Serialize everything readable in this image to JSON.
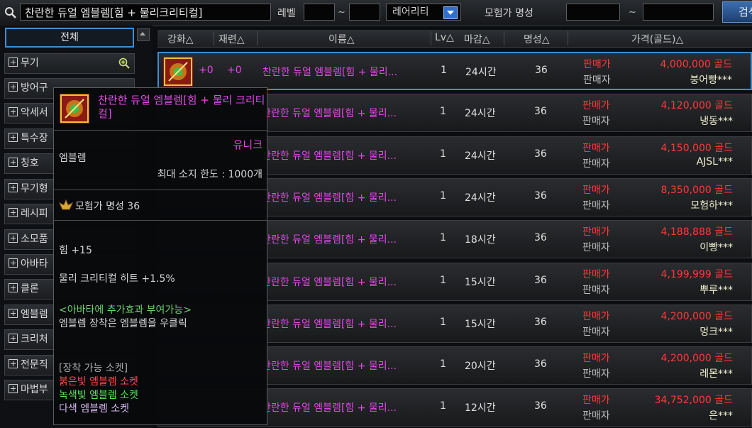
{
  "search": {
    "value": "찬란한 듀얼 엠블렘[힘 + 물리크리티컬]",
    "level_label": "레벨",
    "tilde": "~",
    "rarity": "레어리티",
    "fame_label": "모험가 명성",
    "button": "검색"
  },
  "sidebar": {
    "all": "전체",
    "items": [
      {
        "label": "무기"
      },
      {
        "label": "방어구"
      },
      {
        "label": "악세서"
      },
      {
        "label": "특수장"
      },
      {
        "label": "칭호"
      },
      {
        "label": "무기형"
      },
      {
        "label": "레시피"
      },
      {
        "label": "소모품"
      },
      {
        "label": "아바타"
      },
      {
        "label": "클론"
      },
      {
        "label": "엠블렘"
      },
      {
        "label": "크리처"
      },
      {
        "label": "전문직"
      },
      {
        "label": "마법부"
      }
    ]
  },
  "columns": {
    "enhance": "강화△",
    "refine": "재련△",
    "name": "이름△",
    "lv": "Lv△",
    "deadline": "마감△",
    "fame": "명성△",
    "price": "가격(골드)△"
  },
  "listing_labels": {
    "sell": "판매가",
    "seller": "판매자"
  },
  "rows": [
    {
      "enh": "+0",
      "ref": "+0",
      "name": "찬란한 듀얼 엠블렘[힘 + 물리...",
      "lv": "1",
      "time": "24시간",
      "fame": "36",
      "price": "4,000,000 골드",
      "seller": "붕어빵***"
    },
    {
      "enh": "",
      "ref": "",
      "name": "찬란한 듀얼 엠블렘[힘 + 물리...",
      "lv": "1",
      "time": "24시간",
      "fame": "36",
      "price": "4,120,000 골드",
      "seller": "냉동***"
    },
    {
      "enh": "",
      "ref": "",
      "name": "찬란한 듀얼 엠블렘[힘 + 물리...",
      "lv": "1",
      "time": "24시간",
      "fame": "36",
      "price": "4,150,000 골드",
      "seller": "AJSL***"
    },
    {
      "enh": "",
      "ref": "",
      "name": "찬란한 듀얼 엠블렘[힘 + 물리...",
      "lv": "1",
      "time": "24시간",
      "fame": "36",
      "price": "8,350,000 골드",
      "seller": "모험하***"
    },
    {
      "enh": "",
      "ref": "",
      "name": "찬란한 듀얼 엠블렘[힘 + 물리...",
      "lv": "1",
      "time": "18시간",
      "fame": "36",
      "price": "4,188,888 골드",
      "seller": "이빵***"
    },
    {
      "enh": "",
      "ref": "",
      "name": "찬란한 듀얼 엠블렘[힘 + 물리...",
      "lv": "1",
      "time": "15시간",
      "fame": "36",
      "price": "4,199,999 골드",
      "seller": "뿌루***"
    },
    {
      "enh": "",
      "ref": "",
      "name": "찬란한 듀얼 엠블렘[힘 + 물리...",
      "lv": "1",
      "time": "15시간",
      "fame": "36",
      "price": "4,200,000 골드",
      "seller": "멍크***"
    },
    {
      "enh": "",
      "ref": "",
      "name": "찬란한 듀얼 엠블렘[힘 + 물리...",
      "lv": "1",
      "time": "20시간",
      "fame": "36",
      "price": "4,200,000 골드",
      "seller": "레몬***"
    },
    {
      "enh": "",
      "ref": "",
      "name": "찬란한 듀얼 엠블렘[힘 + 물리...",
      "lv": "1",
      "time": "12시간",
      "fame": "36",
      "price": "34,752,000 골드",
      "seller": "은***"
    }
  ],
  "tooltip": {
    "title": "찬란한 듀얼 엠블렘[힘 + 물리 크리티컬]",
    "rarity": "유니크",
    "type": "엠블렘",
    "limit": "최대 소지 한도 : 1000개",
    "fame": "모험가 명성 36",
    "stat1": "힘 +15",
    "stat2": "물리 크리티컬 히트 +1.5%",
    "avatar_note": "<아바타에 추가효과 부여가능>",
    "equip_note": "엠블렘 장착은 엠블렘을 우클릭",
    "socket_header": "[장착 가능 소켓]",
    "socket_red": "붉은빛 엠블렘 소켓",
    "socket_green": "녹색빛 엠블렘 소켓",
    "socket_multi": "다색 엠블렘 소켓"
  },
  "colors": {
    "unique": "#e448e8",
    "price": "#ff3a3a",
    "selection": "#3b8fd6"
  },
  "icons": [
    "search-icon",
    "zoom-icon",
    "emblem-icon",
    "fame-icon",
    "dropdown-icon"
  ]
}
